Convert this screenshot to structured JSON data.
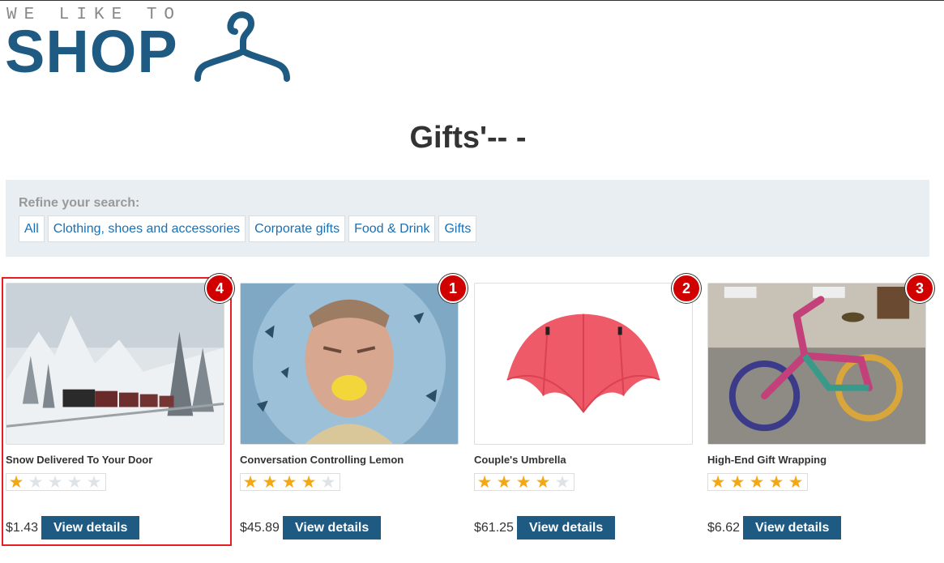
{
  "logo": {
    "tagline": "WE LIKE TO",
    "word": "SHOP",
    "color": "#1e5a82"
  },
  "page_title": "Gifts'-- -",
  "filters": {
    "label": "Refine your search:",
    "items": [
      "All",
      "Clothing, shoes and accessories",
      "Corporate gifts",
      "Food & Drink",
      "Gifts"
    ]
  },
  "products": [
    {
      "name": "Snow Delivered To Your Door",
      "rating": 1,
      "price": "$1.43",
      "button": "View details",
      "badge": "4",
      "image": "snowy-train-image"
    },
    {
      "name": "Conversation Controlling Lemon",
      "rating": 4,
      "price": "$45.89",
      "button": "View details",
      "badge": "1",
      "image": "man-with-lemon-image"
    },
    {
      "name": "Couple's Umbrella",
      "rating": 4,
      "price": "$61.25",
      "button": "View details",
      "badge": "2",
      "image": "red-umbrella-image"
    },
    {
      "name": "High-End Gift Wrapping",
      "rating": 5,
      "price": "$6.62",
      "button": "View details",
      "badge": "3",
      "image": "yarn-bombed-bicycle-image"
    }
  ],
  "colors": {
    "accent": "#1e5a82",
    "link": "#1a6fb3",
    "star": "#f4a711",
    "highlight": "#e81e25",
    "badge": "#d00000"
  }
}
